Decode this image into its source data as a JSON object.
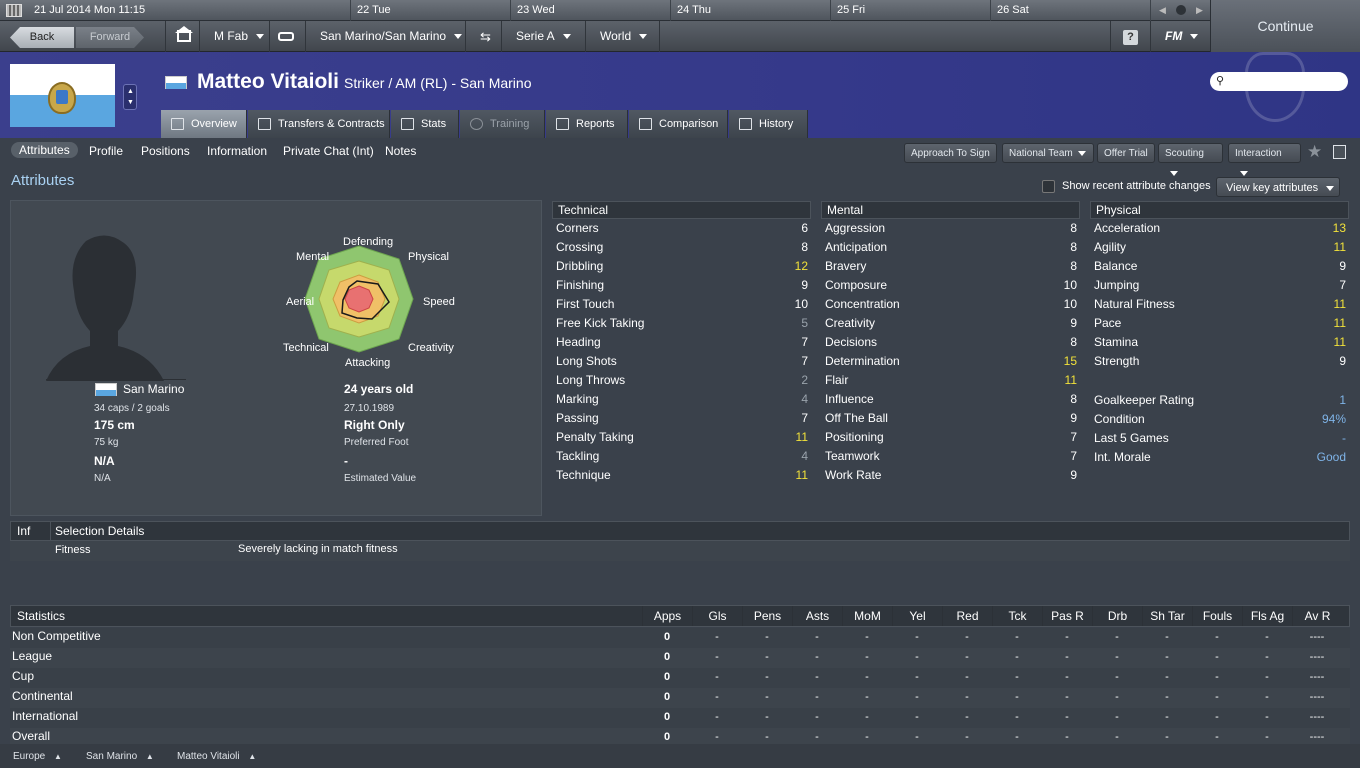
{
  "calendar": {
    "current": "21 Jul 2014  Mon 11:15",
    "days": [
      "22  Tue",
      "23  Wed",
      "24  Thu",
      "25  Fri",
      "26  Sat"
    ]
  },
  "toolbar": {
    "back": "Back",
    "forward": "Forward",
    "manager": "M Fab",
    "club": "San Marino/San Marino",
    "league": "Serie A",
    "world": "World",
    "help": "?",
    "logo": "FM",
    "continue": "Continue"
  },
  "player": {
    "name": "Matteo Vitaioli",
    "position": "Striker / AM (RL) - San Marino"
  },
  "tabs": [
    "Overview",
    "Transfers & Contracts",
    "Stats",
    "Training",
    "Reports",
    "Comparison",
    "History"
  ],
  "subnav": [
    "Attributes",
    "Profile",
    "Positions",
    "Information",
    "Private Chat (Int)",
    "Notes"
  ],
  "actions": [
    "Approach To Sign",
    "National Team",
    "Offer Trial",
    "Scouting",
    "Interaction"
  ],
  "section_title": "Attributes",
  "recent_changes": "Show recent attribute changes",
  "view_key": "View key attributes",
  "radar": {
    "labels": [
      "Defending",
      "Physical",
      "Speed",
      "Creativity",
      "Attacking",
      "Technical",
      "Aerial",
      "Mental"
    ]
  },
  "bio": {
    "nation": "San Marino",
    "caps": "34 caps / 2 goals",
    "age": "24 years old",
    "dob": "27.10.1989",
    "height": "175 cm",
    "foot": "Right Only",
    "weight": "75 kg",
    "foot_label": "Preferred Foot",
    "value_big": "N/A",
    "value_dash": "-",
    "value_small": "N/A",
    "value_label": "Estimated Value"
  },
  "technical": {
    "title": "Technical",
    "rows": [
      {
        "name": "Corners",
        "value": "6"
      },
      {
        "name": "Crossing",
        "value": "8"
      },
      {
        "name": "Dribbling",
        "value": "12"
      },
      {
        "name": "Finishing",
        "value": "9"
      },
      {
        "name": "First Touch",
        "value": "10"
      },
      {
        "name": "Free Kick Taking",
        "value": "5"
      },
      {
        "name": "Heading",
        "value": "7"
      },
      {
        "name": "Long Shots",
        "value": "7"
      },
      {
        "name": "Long Throws",
        "value": "2"
      },
      {
        "name": "Marking",
        "value": "4"
      },
      {
        "name": "Passing",
        "value": "7"
      },
      {
        "name": "Penalty Taking",
        "value": "11"
      },
      {
        "name": "Tackling",
        "value": "4"
      },
      {
        "name": "Technique",
        "value": "11"
      }
    ]
  },
  "mental": {
    "title": "Mental",
    "rows": [
      {
        "name": "Aggression",
        "value": "8"
      },
      {
        "name": "Anticipation",
        "value": "8"
      },
      {
        "name": "Bravery",
        "value": "8"
      },
      {
        "name": "Composure",
        "value": "10"
      },
      {
        "name": "Concentration",
        "value": "10"
      },
      {
        "name": "Creativity",
        "value": "9"
      },
      {
        "name": "Decisions",
        "value": "8"
      },
      {
        "name": "Determination",
        "value": "15"
      },
      {
        "name": "Flair",
        "value": "11"
      },
      {
        "name": "Influence",
        "value": "8"
      },
      {
        "name": "Off The Ball",
        "value": "9"
      },
      {
        "name": "Positioning",
        "value": "7"
      },
      {
        "name": "Teamwork",
        "value": "7"
      },
      {
        "name": "Work Rate",
        "value": "9"
      }
    ]
  },
  "physical": {
    "title": "Physical",
    "rows": [
      {
        "name": "Acceleration",
        "value": "13"
      },
      {
        "name": "Agility",
        "value": "11"
      },
      {
        "name": "Balance",
        "value": "9"
      },
      {
        "name": "Jumping",
        "value": "7"
      },
      {
        "name": "Natural Fitness",
        "value": "11"
      },
      {
        "name": "Pace",
        "value": "11"
      },
      {
        "name": "Stamina",
        "value": "11"
      },
      {
        "name": "Strength",
        "value": "9"
      }
    ],
    "extra": [
      {
        "name": "Goalkeeper Rating",
        "value": "1"
      },
      {
        "name": "Condition",
        "value": "94%"
      },
      {
        "name": "Last 5 Games",
        "value": "-"
      },
      {
        "name": "Int. Morale",
        "value": "Good"
      }
    ]
  },
  "selection": {
    "inf": "Inf",
    "title": "Selection Details",
    "label": "Fitness",
    "text": "Severely lacking in match fitness"
  },
  "stats": {
    "title": "Statistics",
    "columns": [
      "Apps",
      "Gls",
      "Pens",
      "Asts",
      "MoM",
      "Yel",
      "Red",
      "Tck",
      "Pas R",
      "Drb",
      "Sh Tar",
      "Fouls",
      "Fls Ag",
      "Av R"
    ],
    "rows": [
      {
        "name": "Non Competitive",
        "apps": "0"
      },
      {
        "name": "League",
        "apps": "0"
      },
      {
        "name": "Cup",
        "apps": "0"
      },
      {
        "name": "Continental",
        "apps": "0"
      },
      {
        "name": "International",
        "apps": "0"
      },
      {
        "name": "Overall",
        "apps": "0"
      }
    ],
    "dash": "-",
    "avr": "----"
  },
  "breadcrumbs": [
    "Europe",
    "San Marino",
    "Matteo Vitaioli"
  ],
  "colors": {
    "highlight": "#f2e23a",
    "blue": "#7fb4e8",
    "header": "#3b3f8d"
  }
}
